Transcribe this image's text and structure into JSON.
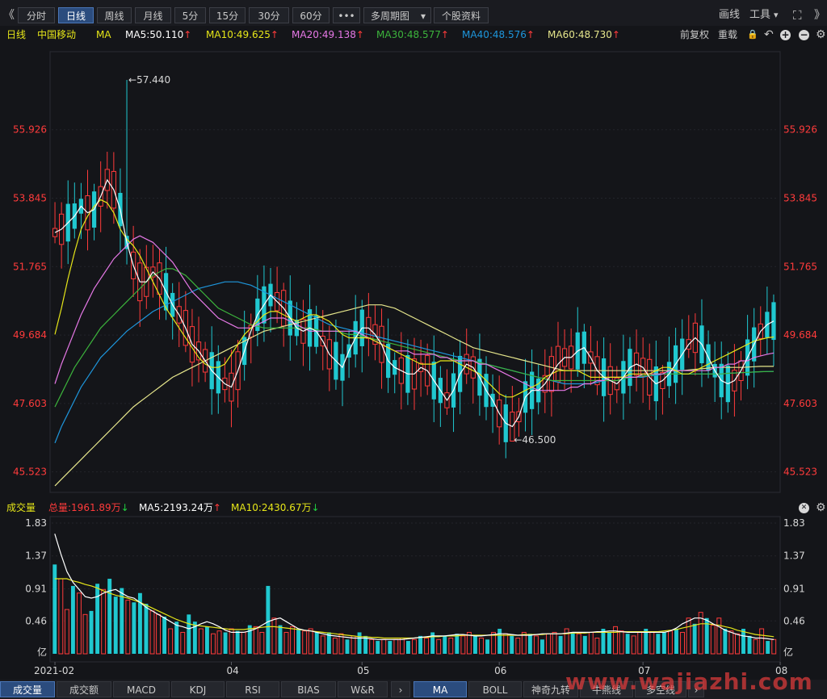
{
  "toolbar": {
    "back_glyph": "《",
    "forward_glyph": "》",
    "periods": [
      "分时",
      "日线",
      "周线",
      "月线",
      "5分",
      "15分",
      "30分",
      "60分"
    ],
    "active_period": "日线",
    "more_glyph": "•••",
    "multi_period": "多周期图",
    "stock_info": "个股资料",
    "draw": "画线",
    "tools": "工具",
    "fullscreen_glyph": "⛶"
  },
  "indicator_row": {
    "period": "日线",
    "stock": "中国移动",
    "ma": "MA",
    "ma5": "MA5:50.110",
    "ma10": "MA10:49.625",
    "ma20": "MA20:49.138",
    "ma30": "MA30:48.577",
    "ma40": "MA40:48.576",
    "ma60": "MA60:48.730",
    "arrow": "↑",
    "adjust": "前复权",
    "overlay": "重载",
    "lock_glyph": "🔒",
    "undo_glyph": "↶",
    "zoom_in_glyph": "+",
    "zoom_out_glyph": "−",
    "settings_glyph": "⚙"
  },
  "colors": {
    "up": "#ff3b3b",
    "down": "#20c8d0",
    "ma5": "#ffffff",
    "ma10": "#e6e619",
    "ma20": "#e678e6",
    "ma30": "#3cb43c",
    "ma40": "#1e96dc",
    "ma60": "#e6e68c",
    "label_red": "#ff3b3b"
  },
  "chart_data": {
    "type": "candlestick",
    "stock": "中国移动",
    "period": "日线",
    "price_ticks": [
      55.926,
      53.845,
      51.765,
      49.684,
      47.603,
      45.523
    ],
    "price_range": [
      44.9,
      58.3
    ],
    "high_label": "57.440",
    "low_label": "46.500",
    "high_price": 57.44,
    "low_price": 46.5,
    "x_labels": [
      "2021-02",
      "04",
      "05",
      "06",
      "07",
      "08"
    ],
    "x_label_bars": [
      0,
      27,
      47,
      68,
      90,
      111
    ],
    "ma5_path": [
      52.8,
      52.9,
      53.1,
      53.3,
      53.6,
      53.4,
      53.5,
      53.9,
      54.4,
      54.1,
      53.5,
      52.5,
      51.8,
      51.3,
      51.3,
      51.6,
      51.4,
      51.0,
      50.6,
      50.3,
      49.9,
      49.4,
      49.2,
      48.9,
      48.6,
      48.4,
      48.2,
      48.1,
      48.6,
      49.2,
      49.8,
      50.3,
      50.6,
      50.9,
      50.7,
      50.5,
      50.2,
      49.9,
      49.8,
      49.9,
      49.8,
      49.5,
      49.1,
      48.9,
      48.7,
      49.2,
      49.6,
      49.9,
      49.9,
      49.7,
      49.4,
      48.9,
      48.7,
      48.6,
      48.5,
      48.5,
      48.7,
      48.6,
      48.3,
      48.0,
      47.7,
      48.0,
      48.5,
      48.8,
      48.7,
      48.4,
      48.0,
      47.7,
      47.3,
      47.0,
      46.9,
      47.2,
      47.8,
      48.0,
      48.0,
      48.2,
      48.5,
      48.8,
      49.0,
      49.0,
      49.2,
      49.3,
      49.0,
      48.6,
      48.4,
      48.3,
      48.2,
      48.4,
      48.7,
      48.8,
      48.7,
      48.4,
      48.2,
      48.3,
      48.5,
      48.8,
      49.1,
      49.4,
      49.6,
      49.4,
      49.0,
      48.6,
      48.3,
      48.2,
      48.3,
      48.6,
      49.0,
      49.4,
      49.8,
      50.0,
      50.11
    ],
    "ma10_path": [
      49.7,
      50.5,
      51.4,
      52.2,
      52.9,
      53.3,
      53.6,
      53.8,
      53.7,
      53.4,
      52.9,
      52.6,
      52.4,
      52.1,
      51.7,
      51.3,
      50.9,
      50.5,
      50.2,
      49.9,
      49.6,
      49.3,
      49.0,
      48.8,
      48.7,
      48.7,
      48.8,
      49.1,
      49.4,
      49.7,
      49.9,
      50.1,
      50.3,
      50.4,
      50.4,
      50.3,
      50.2,
      50.1,
      50.2,
      50.3,
      50.3,
      50.2,
      50.1,
      49.9,
      49.7,
      49.6,
      49.6,
      49.6,
      49.6,
      49.5,
      49.4,
      49.3,
      49.2,
      49.1,
      49.0,
      48.9,
      48.8,
      48.8,
      48.8,
      48.9,
      48.9,
      48.9,
      48.8,
      48.7,
      48.6,
      48.5,
      48.3,
      48.1,
      47.9,
      47.8,
      47.8,
      47.9,
      48.0,
      48.1,
      48.2,
      48.4,
      48.5,
      48.6,
      48.6,
      48.6,
      48.6,
      48.5,
      48.4,
      48.4,
      48.4,
      48.4,
      48.4,
      48.4,
      48.5,
      48.5,
      48.5,
      48.5,
      48.6,
      48.7,
      48.7,
      48.6,
      48.5,
      48.5,
      48.6,
      48.7,
      48.8,
      48.9,
      49.0,
      49.1,
      49.2,
      49.3,
      49.4,
      49.5,
      49.55,
      49.6,
      49.625
    ],
    "ma20_path": [
      48.2,
      48.8,
      49.3,
      49.8,
      50.3,
      50.7,
      51.1,
      51.4,
      51.7,
      52.0,
      52.2,
      52.4,
      52.6,
      52.7,
      52.6,
      52.5,
      52.3,
      52.1,
      51.9,
      51.6,
      51.3,
      51.0,
      50.8,
      50.6,
      50.4,
      50.2,
      50.1,
      50.0,
      49.9,
      49.9,
      49.9,
      50.0,
      50.1,
      50.2,
      50.2,
      50.2,
      50.1,
      50.0,
      49.9,
      49.8,
      49.8,
      49.8,
      49.8,
      49.8,
      49.8,
      49.8,
      49.8,
      49.7,
      49.6,
      49.5,
      49.4,
      49.3,
      49.2,
      49.2,
      49.2,
      49.1,
      49.1,
      49.1,
      49.1,
      49.0,
      49.0,
      48.9,
      48.9,
      48.9,
      48.9,
      48.8,
      48.8,
      48.7,
      48.6,
      48.5,
      48.4,
      48.3,
      48.2,
      48.1,
      48.0,
      48.0,
      48.0,
      48.0,
      48.0,
      48.1,
      48.1,
      48.2,
      48.2,
      48.3,
      48.3,
      48.4,
      48.4,
      48.4,
      48.4,
      48.4,
      48.5,
      48.5,
      48.5,
      48.5,
      48.6,
      48.6,
      48.6,
      48.6,
      48.6,
      48.6,
      48.6,
      48.7,
      48.7,
      48.8,
      48.8,
      48.9,
      48.9,
      49.0,
      49.05,
      49.1,
      49.138
    ],
    "ma30_path": [
      47.5,
      47.9,
      48.3,
      48.7,
      49.0,
      49.3,
      49.6,
      49.9,
      50.1,
      50.3,
      50.5,
      50.7,
      50.9,
      51.1,
      51.3,
      51.5,
      51.6,
      51.7,
      51.7,
      51.6,
      51.5,
      51.3,
      51.1,
      50.9,
      50.7,
      50.5,
      50.4,
      50.3,
      50.2,
      50.1,
      50.0,
      49.95,
      49.9,
      49.9,
      49.9,
      49.9,
      49.9,
      49.9,
      49.9,
      49.9,
      49.85,
      49.8,
      49.8,
      49.8,
      49.75,
      49.7,
      49.7,
      49.65,
      49.6,
      49.55,
      49.5,
      49.45,
      49.4,
      49.35,
      49.3,
      49.25,
      49.2,
      49.15,
      49.1,
      49.05,
      49.0,
      48.95,
      48.9,
      48.9,
      48.9,
      48.85,
      48.8,
      48.75,
      48.7,
      48.65,
      48.6,
      48.55,
      48.5,
      48.45,
      48.4,
      48.35,
      48.3,
      48.3,
      48.3,
      48.3,
      48.3,
      48.3,
      48.3,
      48.3,
      48.3,
      48.3,
      48.3,
      48.35,
      48.4,
      48.4,
      48.45,
      48.45,
      48.5,
      48.5,
      48.5,
      48.5,
      48.5,
      48.5,
      48.5,
      48.5,
      48.5,
      48.5,
      48.5,
      48.52,
      48.53,
      48.54,
      48.55,
      48.56,
      48.57,
      48.575,
      48.577
    ],
    "ma40_path": [
      46.4,
      46.9,
      47.3,
      47.7,
      48.1,
      48.4,
      48.7,
      49.0,
      49.2,
      49.4,
      49.6,
      49.8,
      49.95,
      50.1,
      50.25,
      50.4,
      50.5,
      50.6,
      50.7,
      50.8,
      50.9,
      51.0,
      51.1,
      51.15,
      51.2,
      51.25,
      51.3,
      51.3,
      51.3,
      51.25,
      51.2,
      51.1,
      51.0,
      50.9,
      50.8,
      50.7,
      50.6,
      50.5,
      50.4,
      50.3,
      50.2,
      50.1,
      50.0,
      49.95,
      49.9,
      49.85,
      49.8,
      49.75,
      49.7,
      49.65,
      49.6,
      49.55,
      49.5,
      49.45,
      49.4,
      49.35,
      49.3,
      49.25,
      49.2,
      49.15,
      49.1,
      49.05,
      49.0,
      48.95,
      48.9,
      48.85,
      48.8,
      48.75,
      48.7,
      48.65,
      48.6,
      48.55,
      48.5,
      48.45,
      48.4,
      48.35,
      48.3,
      48.25,
      48.2,
      48.2,
      48.2,
      48.2,
      48.2,
      48.25,
      48.3,
      48.3,
      48.3,
      48.35,
      48.4,
      48.4,
      48.4,
      48.45,
      48.45,
      48.5,
      48.5,
      48.5,
      48.5,
      48.5,
      48.5,
      48.5,
      48.5,
      48.5,
      48.5,
      48.52,
      48.53,
      48.54,
      48.55,
      48.56,
      48.57,
      48.575,
      48.576
    ],
    "ma60_path": [
      45.1,
      45.3,
      45.5,
      45.7,
      45.9,
      46.1,
      46.3,
      46.5,
      46.7,
      46.9,
      47.1,
      47.3,
      47.5,
      47.65,
      47.8,
      47.95,
      48.1,
      48.25,
      48.4,
      48.5,
      48.6,
      48.7,
      48.8,
      48.9,
      49.0,
      49.1,
      49.2,
      49.3,
      49.4,
      49.5,
      49.6,
      49.7,
      49.8,
      49.85,
      49.9,
      49.95,
      50.0,
      50.05,
      50.1,
      50.15,
      50.2,
      50.25,
      50.3,
      50.35,
      50.4,
      50.45,
      50.5,
      50.55,
      50.6,
      50.6,
      50.6,
      50.55,
      50.5,
      50.4,
      50.3,
      50.2,
      50.1,
      50.0,
      49.9,
      49.8,
      49.7,
      49.6,
      49.5,
      49.4,
      49.3,
      49.25,
      49.2,
      49.15,
      49.1,
      49.05,
      49.0,
      48.95,
      48.9,
      48.85,
      48.8,
      48.75,
      48.7,
      48.65,
      48.6,
      48.6,
      48.6,
      48.6,
      48.6,
      48.6,
      48.6,
      48.6,
      48.6,
      48.6,
      48.6,
      48.6,
      48.6,
      48.6,
      48.6,
      48.6,
      48.6,
      48.6,
      48.6,
      48.62,
      48.64,
      48.66,
      48.68,
      48.7,
      48.7,
      48.7,
      48.7,
      48.7,
      48.71,
      48.72,
      48.73,
      48.73,
      48.73
    ]
  },
  "volume": {
    "title": "成交量",
    "total": "总量:1961.89万",
    "ma5": "MA5:2193.24万",
    "ma10": "MA10:2430.67万",
    "down_arrow": "↓",
    "ticks": [
      "1.83",
      "1.37",
      "0.91",
      "0.46"
    ],
    "tick_values": [
      1.83,
      1.37,
      0.91,
      0.46
    ],
    "unit": "亿",
    "close_glyph": "✕",
    "settings_glyph": "⚙",
    "bars": [
      1.25,
      1.05,
      0.62,
      0.95,
      0.85,
      0.55,
      0.6,
      0.98,
      0.9,
      1.05,
      0.8,
      0.92,
      0.75,
      0.72,
      0.85,
      0.7,
      0.6,
      0.55,
      0.52,
      0.35,
      0.45,
      0.3,
      0.55,
      0.45,
      0.35,
      0.38,
      0.28,
      0.32,
      0.3,
      0.35,
      0.32,
      0.3,
      0.4,
      0.38,
      0.3,
      0.95,
      0.5,
      0.4,
      0.3,
      0.38,
      0.35,
      0.32,
      0.35,
      0.3,
      0.25,
      0.3,
      0.22,
      0.28,
      0.2,
      0.25,
      0.3,
      0.25,
      0.2,
      0.18,
      0.2,
      0.18,
      0.2,
      0.22,
      0.18,
      0.2,
      0.25,
      0.22,
      0.3,
      0.2,
      0.25,
      0.22,
      0.28,
      0.25,
      0.3,
      0.25,
      0.22,
      0.2,
      0.3,
      0.35,
      0.28,
      0.25,
      0.22,
      0.3,
      0.28,
      0.25,
      0.2,
      0.28,
      0.3,
      0.25,
      0.35,
      0.3,
      0.28,
      0.25,
      0.3,
      0.22,
      0.35,
      0.3,
      0.38,
      0.32,
      0.28,
      0.25,
      0.3,
      0.35,
      0.3,
      0.28,
      0.3,
      0.32,
      0.35,
      0.3,
      0.5,
      0.42,
      0.58,
      0.5,
      0.4,
      0.5,
      0.35,
      0.32,
      0.28,
      0.35,
      0.25,
      0.2,
      0.35,
      0.18,
      0.2
    ],
    "bar_up": [
      false,
      true,
      true,
      false,
      true,
      true,
      false,
      false,
      true,
      false,
      false,
      false,
      true,
      false,
      false,
      false,
      true,
      true,
      false,
      true,
      false,
      true,
      false,
      false,
      true,
      false,
      true,
      true,
      false,
      true,
      false,
      true,
      false,
      true,
      true,
      false,
      true,
      false,
      true,
      true,
      false,
      true,
      true,
      false,
      true,
      false,
      true,
      true,
      false,
      true,
      false,
      false,
      true,
      false,
      true,
      false,
      true,
      true,
      false,
      true,
      false,
      true,
      false,
      true,
      false,
      true,
      false,
      true,
      true,
      false,
      true,
      false,
      true,
      false,
      true,
      false,
      true,
      true,
      false,
      true,
      false,
      true,
      true,
      false,
      true,
      false,
      true,
      false,
      true,
      true,
      false,
      false,
      true,
      true,
      false,
      true,
      true,
      false,
      true,
      false,
      false,
      true,
      false,
      true,
      true,
      false,
      true,
      false,
      true,
      true,
      false,
      true,
      true,
      false,
      false,
      true,
      true,
      false,
      true
    ],
    "ma5_path": [
      1.68,
      1.4,
      1.15,
      1.0,
      0.9,
      0.8,
      0.78,
      0.8,
      0.85,
      0.88,
      0.9,
      0.85,
      0.8,
      0.78,
      0.72,
      0.65,
      0.6,
      0.55,
      0.5,
      0.45,
      0.4,
      0.38,
      0.35,
      0.38,
      0.42,
      0.45,
      0.42,
      0.38,
      0.33,
      0.3,
      0.3,
      0.3,
      0.32,
      0.35,
      0.4,
      0.45,
      0.48,
      0.5,
      0.45,
      0.4,
      0.35,
      0.33,
      0.32,
      0.3,
      0.28,
      0.26,
      0.25,
      0.24,
      0.23,
      0.22,
      0.22,
      0.22,
      0.21,
      0.2,
      0.2,
      0.2,
      0.2,
      0.2,
      0.21,
      0.22,
      0.23,
      0.24,
      0.25,
      0.25,
      0.25,
      0.26,
      0.27,
      0.27,
      0.26,
      0.25,
      0.25,
      0.26,
      0.27,
      0.28,
      0.28,
      0.27,
      0.26,
      0.26,
      0.26,
      0.27,
      0.28,
      0.28,
      0.28,
      0.28,
      0.29,
      0.3,
      0.3,
      0.3,
      0.3,
      0.31,
      0.31,
      0.32,
      0.32,
      0.31,
      0.3,
      0.3,
      0.3,
      0.3,
      0.3,
      0.3,
      0.3,
      0.32,
      0.36,
      0.42,
      0.46,
      0.5,
      0.5,
      0.47,
      0.42,
      0.38,
      0.33,
      0.3,
      0.27,
      0.25,
      0.24,
      0.22,
      0.22,
      0.21,
      0.2
    ],
    "ma10_path": [
      1.05,
      1.05,
      1.05,
      1.02,
      1.0,
      0.97,
      0.95,
      0.92,
      0.88,
      0.85,
      0.82,
      0.8,
      0.78,
      0.75,
      0.72,
      0.68,
      0.64,
      0.6,
      0.56,
      0.52,
      0.48,
      0.45,
      0.42,
      0.4,
      0.39,
      0.38,
      0.37,
      0.36,
      0.35,
      0.34,
      0.34,
      0.34,
      0.35,
      0.36,
      0.37,
      0.38,
      0.38,
      0.37,
      0.36,
      0.35,
      0.34,
      0.33,
      0.32,
      0.31,
      0.3,
      0.29,
      0.28,
      0.27,
      0.26,
      0.25,
      0.24,
      0.24,
      0.23,
      0.23,
      0.22,
      0.22,
      0.22,
      0.22,
      0.22,
      0.22,
      0.23,
      0.23,
      0.24,
      0.24,
      0.25,
      0.25,
      0.25,
      0.26,
      0.26,
      0.26,
      0.26,
      0.26,
      0.26,
      0.26,
      0.26,
      0.26,
      0.26,
      0.27,
      0.27,
      0.27,
      0.27,
      0.28,
      0.28,
      0.28,
      0.28,
      0.29,
      0.29,
      0.29,
      0.3,
      0.3,
      0.3,
      0.3,
      0.3,
      0.31,
      0.31,
      0.31,
      0.31,
      0.31,
      0.31,
      0.31,
      0.32,
      0.33,
      0.34,
      0.36,
      0.38,
      0.4,
      0.42,
      0.42,
      0.41,
      0.4,
      0.38,
      0.36,
      0.33,
      0.31,
      0.29,
      0.27,
      0.26,
      0.25,
      0.24
    ]
  },
  "bottom_tabs": [
    "成交量",
    "成交额",
    "MACD",
    "KDJ",
    "RSI",
    "BIAS",
    "W&R",
    "›",
    "MA",
    "BOLL",
    "神奇九转",
    "牛熊线",
    "多空线",
    "›"
  ],
  "watermark": "www.wajiazhi.com"
}
